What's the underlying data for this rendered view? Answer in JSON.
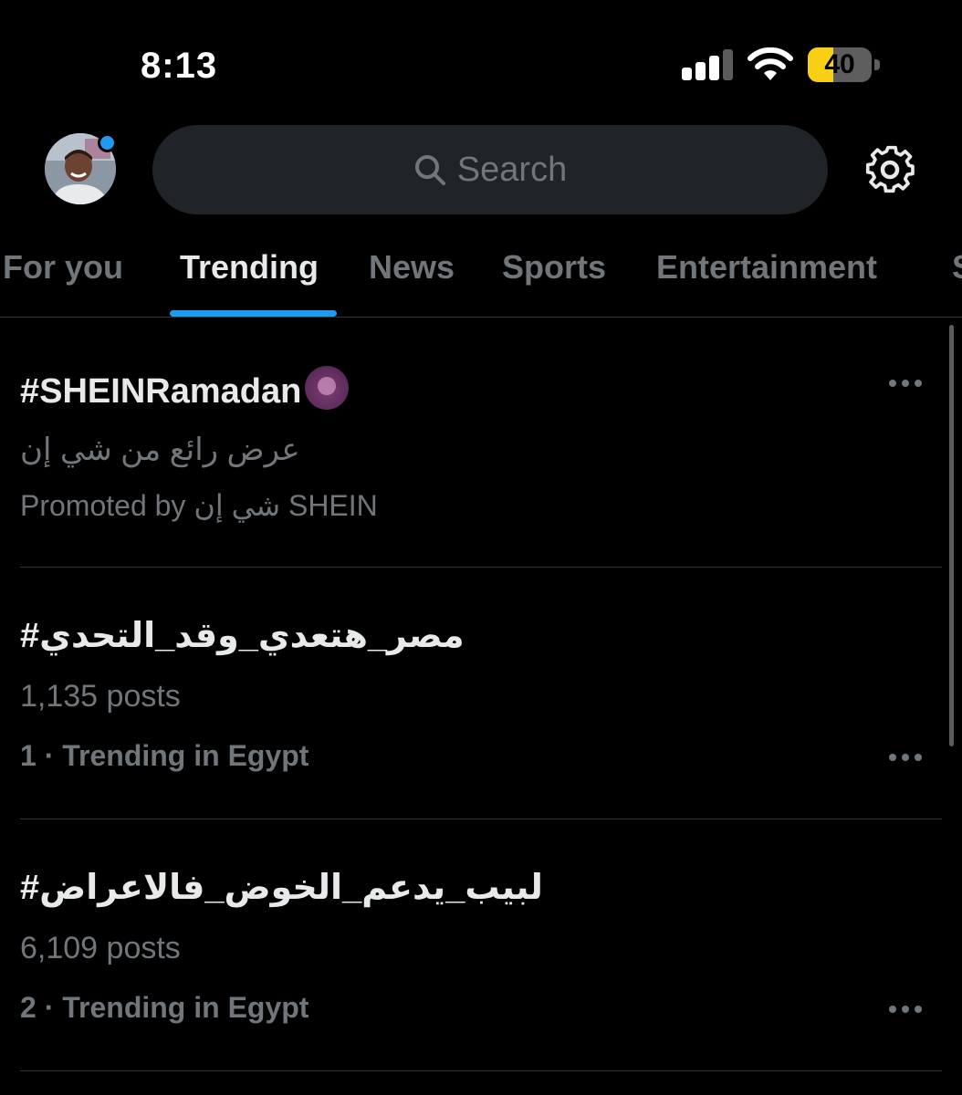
{
  "status_bar": {
    "time": "8:13",
    "battery": "40",
    "battery_level": 0.4,
    "signal_bars_on": 3,
    "signal_bars_total": 4,
    "battery_color": "#f7cf15"
  },
  "header": {
    "search_placeholder": "Search",
    "settings_icon": "gear-icon",
    "avatar_badge_color": "#1d9bf0"
  },
  "tabs": [
    {
      "label": "For you"
    },
    {
      "label": "Trending",
      "active": true
    },
    {
      "label": "News"
    },
    {
      "label": "Sports"
    },
    {
      "label": "Entertainment"
    },
    {
      "label": "S"
    }
  ],
  "trends": [
    {
      "title": "#SHEINRamadan",
      "description": "عرض رائع من شي إن",
      "meta": "Promoted by شي إن SHEIN",
      "promoted": true
    },
    {
      "title": "#مصر_هتعدي_وقد_التحدي",
      "posts": "1,135 posts",
      "meta": "1 · Trending in Egypt"
    },
    {
      "title": "#لبيب_يدعم_الخوض_فالاعراض",
      "posts": "6,109 posts",
      "meta": "2 · Trending in Egypt"
    }
  ],
  "colors": {
    "accent": "#1d9bf0",
    "text_primary": "#e7e9ea",
    "text_secondary": "#71767b",
    "divider": "#2f3336"
  }
}
